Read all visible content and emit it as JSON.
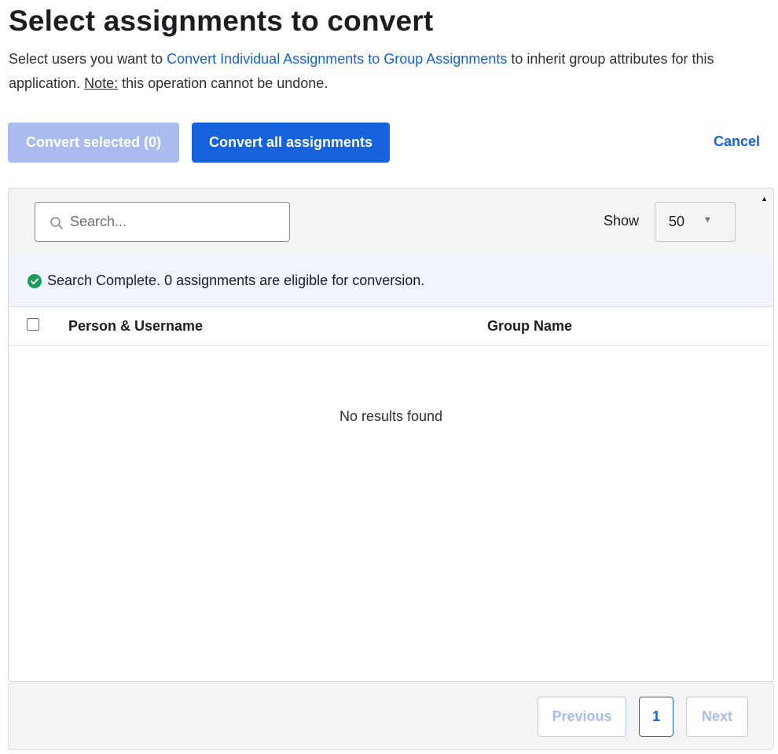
{
  "page": {
    "title": "Select assignments to convert",
    "description": {
      "before": "Select users you want to ",
      "link": "Convert Individual Assignments to Group Assignments",
      "after": " to inherit group attributes for this application. ",
      "note_label": "Note:",
      "note_text": " this operation cannot be undone."
    }
  },
  "actions": {
    "convert_selected": "Convert selected (0)",
    "convert_all": "Convert all assignments",
    "cancel": "Cancel"
  },
  "toolbar": {
    "search_placeholder": "Search...",
    "show_label": "Show",
    "page_size": "50"
  },
  "banner": {
    "message": "Search Complete. 0 assignments are eligible for conversion."
  },
  "table": {
    "columns": [
      "Person & Username",
      "Group Name"
    ],
    "rows": [],
    "empty_message": "No results found"
  },
  "pagination": {
    "previous": "Previous",
    "current_page": "1",
    "next": "Next"
  },
  "colors": {
    "primary": "#1662dd",
    "disabled_primary": "#a9bbef",
    "success": "#1a9c5b"
  },
  "icons": {
    "search": "search-icon",
    "success": "check-circle-icon",
    "dropdown": "caret-down-icon",
    "scroll": "scroll-up-arrow-icon"
  }
}
